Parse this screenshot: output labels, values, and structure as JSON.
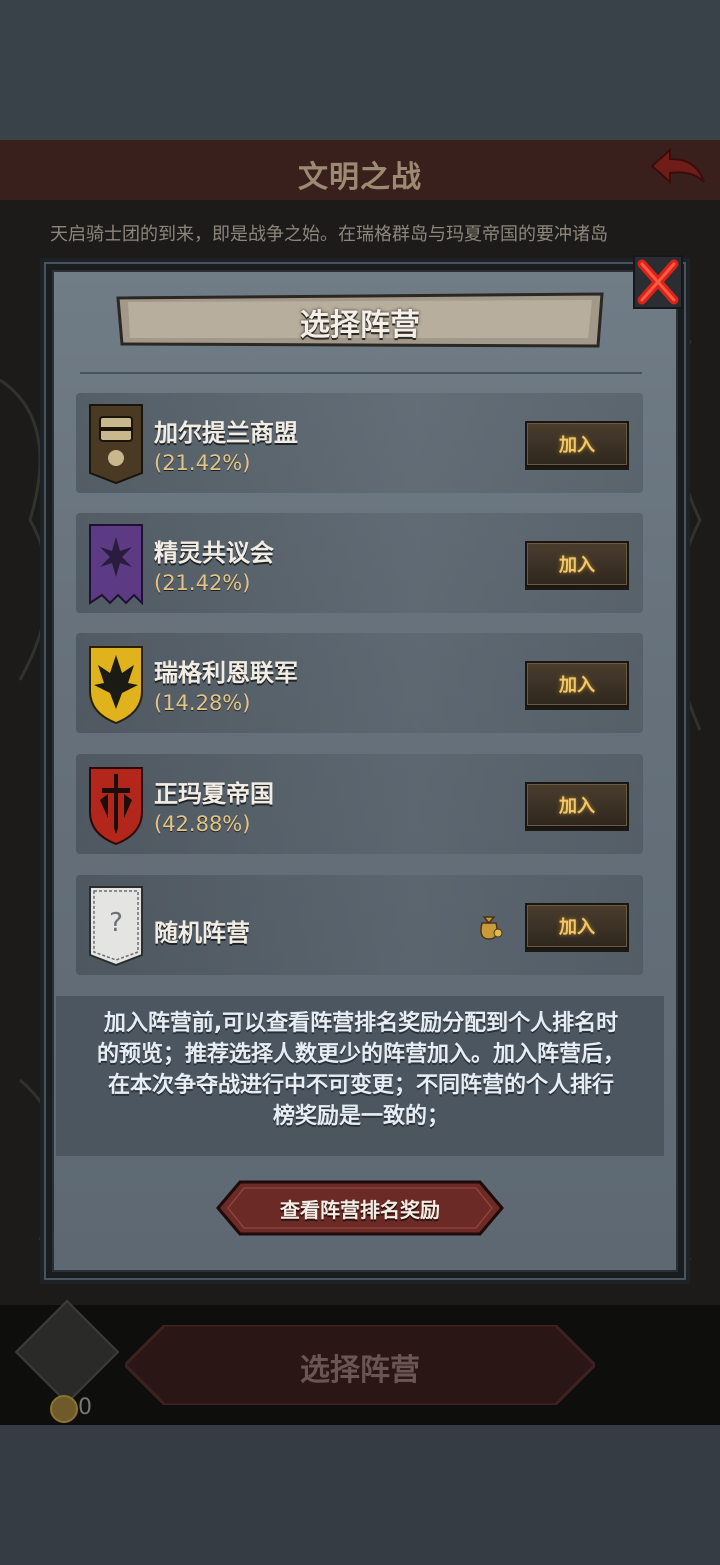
{
  "background_screen": {
    "title": "文明之战",
    "intro_text": "天启骑士团的到来，即是战争之始。在瑞格群岛与玛夏帝国的要冲诸岛",
    "coin_count": "0",
    "select_button_label": "选择阵营"
  },
  "dialog": {
    "title": "选择阵营",
    "factions": [
      {
        "name": "加尔提兰商盟",
        "share": "(21.42%)",
        "join_label": "加入",
        "crest_icon": "treasure-chest-banner"
      },
      {
        "name": "精灵共议会",
        "share": "(21.42%)",
        "join_label": "加入",
        "crest_icon": "purple-flower-banner"
      },
      {
        "name": "瑞格利恩联军",
        "share": "(14.28%)",
        "join_label": "加入",
        "crest_icon": "yellow-eagle-shield"
      },
      {
        "name": "正玛夏帝国",
        "share": "(42.88%)",
        "join_label": "加入",
        "crest_icon": "red-sword-shield"
      },
      {
        "name": "随机阵营",
        "join_label": "加入",
        "crest_icon": "question-banner",
        "extra_icon": "coin-pouch-icon"
      }
    ],
    "info_lines": [
      "加入阵营前,可以查看阵营排名奖励分配到个人排名时",
      "的预览；推荐选择人数更少的阵营加入。加入阵营后，",
      "在本次争夺战进行中不可变更；不同阵营的个人排行",
      "榜奖励是一致的；"
    ],
    "rank_button_label": "查看阵营排名奖励"
  },
  "colors": {
    "panel": "#66717b",
    "join_text": "#f0c869",
    "percent_text": "#e2c487",
    "close_red": "#d8231b",
    "rank_button": "#6b2a26"
  }
}
